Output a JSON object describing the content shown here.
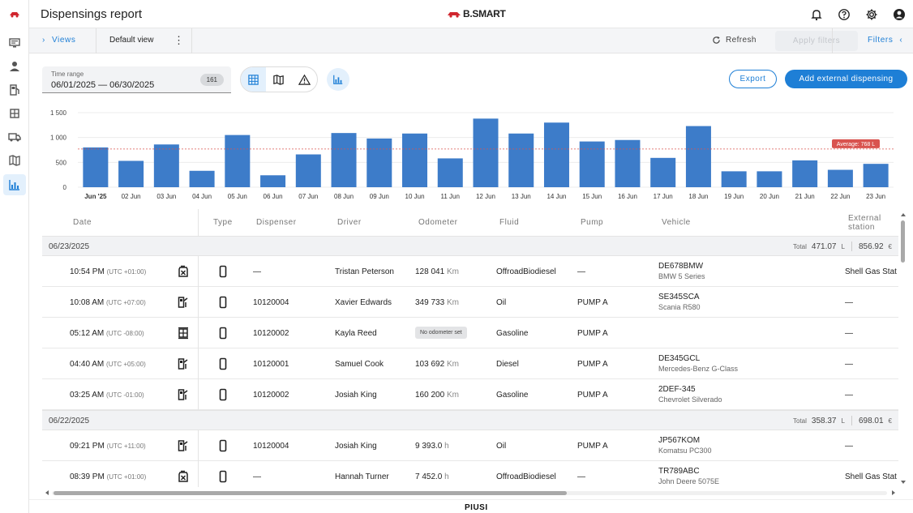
{
  "app": {
    "title": "Dispensings report",
    "brand": "B.SMART",
    "footer_logo": "PIUSI"
  },
  "colors": {
    "accent": "#1e7fd6",
    "bar": "#3d7cc9",
    "average_line": "#d9534f",
    "brand_red": "#d0262e"
  },
  "header_icons": [
    "bell-icon",
    "help-icon",
    "gear-icon",
    "account-icon"
  ],
  "rail_icons": [
    "logo-icon",
    "monitor-icon",
    "user-icon",
    "station-icon",
    "dispenser-icon",
    "truck-icon",
    "map-icon",
    "report-icon"
  ],
  "views": {
    "toggle_label": "Views",
    "default_view": "Default view",
    "refresh_label": "Refresh",
    "apply_filters_label": "Apply filters",
    "filters_label": "Filters"
  },
  "toolbar": {
    "time_range_label": "Time range",
    "time_range_value": "06/01/2025 — 06/30/2025",
    "count": "161",
    "export_label": "Export",
    "add_label": "Add external dispensing"
  },
  "chart_data": {
    "type": "bar",
    "categories": [
      "Jun '25",
      "02 Jun",
      "03 Jun",
      "04 Jun",
      "05 Jun",
      "06 Jun",
      "07 Jun",
      "08 Jun",
      "09 Jun",
      "10 Jun",
      "11 Jun",
      "12 Jun",
      "13 Jun",
      "14 Jun",
      "15 Jun",
      "16 Jun",
      "17 Jun",
      "18 Jun",
      "19 Jun",
      "20 Jun",
      "21 Jun",
      "22 Jun",
      "23 Jun"
    ],
    "values": [
      800,
      530,
      860,
      330,
      1050,
      240,
      660,
      1090,
      980,
      1080,
      580,
      1380,
      1080,
      1300,
      920,
      950,
      590,
      1230,
      320,
      320,
      540,
      350,
      470
    ],
    "ylim": [
      0,
      1500
    ],
    "yticks": [
      "0",
      "500",
      "1 000",
      "1 500"
    ],
    "ytick_values": [
      0,
      500,
      1000,
      1500
    ],
    "average": 768,
    "average_label": "Average: 768 L",
    "grid": true
  },
  "table": {
    "columns": {
      "date": "Date",
      "type": "Type",
      "dispenser": "Dispenser",
      "driver": "Driver",
      "odometer": "Odometer",
      "fluid": "Fluid",
      "pump": "Pump",
      "vehicle": "Vehicle",
      "external_1": "External",
      "external_2": "station"
    },
    "groups": [
      {
        "date": "06/23/2025",
        "total_label": "Total",
        "total_liters": "471.07",
        "liters_unit": "L",
        "total_cost": "856.92",
        "cost_unit": "€",
        "rows": [
          {
            "time": "10:54 PM",
            "tz": "(UTC +01:00)",
            "icon": "fuel-can-icon",
            "dispenser": "—",
            "driver": "Tristan Peterson",
            "odometer": "128 041",
            "odo_unit": "Km",
            "fluid": "OffroadBiodiesel",
            "pump": "—",
            "plate": "DE678BMW",
            "model": "BMW 5 Series",
            "external": "Shell Gas Stat"
          },
          {
            "time": "10:08 AM",
            "tz": "(UTC +07:00)",
            "icon": "fuel-station-icon",
            "dispenser": "10120004",
            "driver": "Xavier Edwards",
            "odometer": "349 733",
            "odo_unit": "Km",
            "fluid": "Oil",
            "pump": "PUMP A",
            "plate": "SE345SCA",
            "model": "Scania R580",
            "external": "—"
          },
          {
            "time": "05:12 AM",
            "tz": "(UTC -08:00)",
            "icon": "dispenser-icon",
            "dispenser": "10120002",
            "driver": "Kayla Reed",
            "odometer_badge": "No odometer set",
            "fluid": "Gasoline",
            "pump": "PUMP A",
            "plate": "",
            "model": "",
            "external": "—"
          },
          {
            "time": "04:40 AM",
            "tz": "(UTC +05:00)",
            "icon": "fuel-station-icon",
            "dispenser": "10120001",
            "driver": "Samuel Cook",
            "odometer": "103 692",
            "odo_unit": "Km",
            "fluid": "Diesel",
            "pump": "PUMP A",
            "plate": "DE345GCL",
            "model": "Mercedes-Benz G-Class",
            "external": "—"
          },
          {
            "time": "03:25 AM",
            "tz": "(UTC -01:00)",
            "icon": "fuel-station-icon",
            "dispenser": "10120002",
            "driver": "Josiah King",
            "odometer": "160 200",
            "odo_unit": "Km",
            "fluid": "Gasoline",
            "pump": "PUMP A",
            "plate": "2DEF-345",
            "model": "Chevrolet Silverado",
            "external": "—"
          }
        ]
      },
      {
        "date": "06/22/2025",
        "total_label": "Total",
        "total_liters": "358.37",
        "liters_unit": "L",
        "total_cost": "698.01",
        "cost_unit": "€",
        "rows": [
          {
            "time": "09:21 PM",
            "tz": "(UTC +11:00)",
            "icon": "fuel-station-icon",
            "dispenser": "10120004",
            "driver": "Josiah King",
            "odometer": "9 393.0",
            "odo_unit": "h",
            "fluid": "Oil",
            "pump": "PUMP A",
            "plate": "JP567KOM",
            "model": "Komatsu PC300",
            "external": "—"
          },
          {
            "time": "08:39 PM",
            "tz": "(UTC +01:00)",
            "icon": "fuel-can-icon",
            "dispenser": "—",
            "driver": "Hannah Turner",
            "odometer": "7 452.0",
            "odo_unit": "h",
            "fluid": "OffroadBiodiesel",
            "pump": "—",
            "plate": "TR789ABC",
            "model": "John Deere 5075E",
            "external": "Shell Gas Stat"
          }
        ]
      }
    ]
  }
}
